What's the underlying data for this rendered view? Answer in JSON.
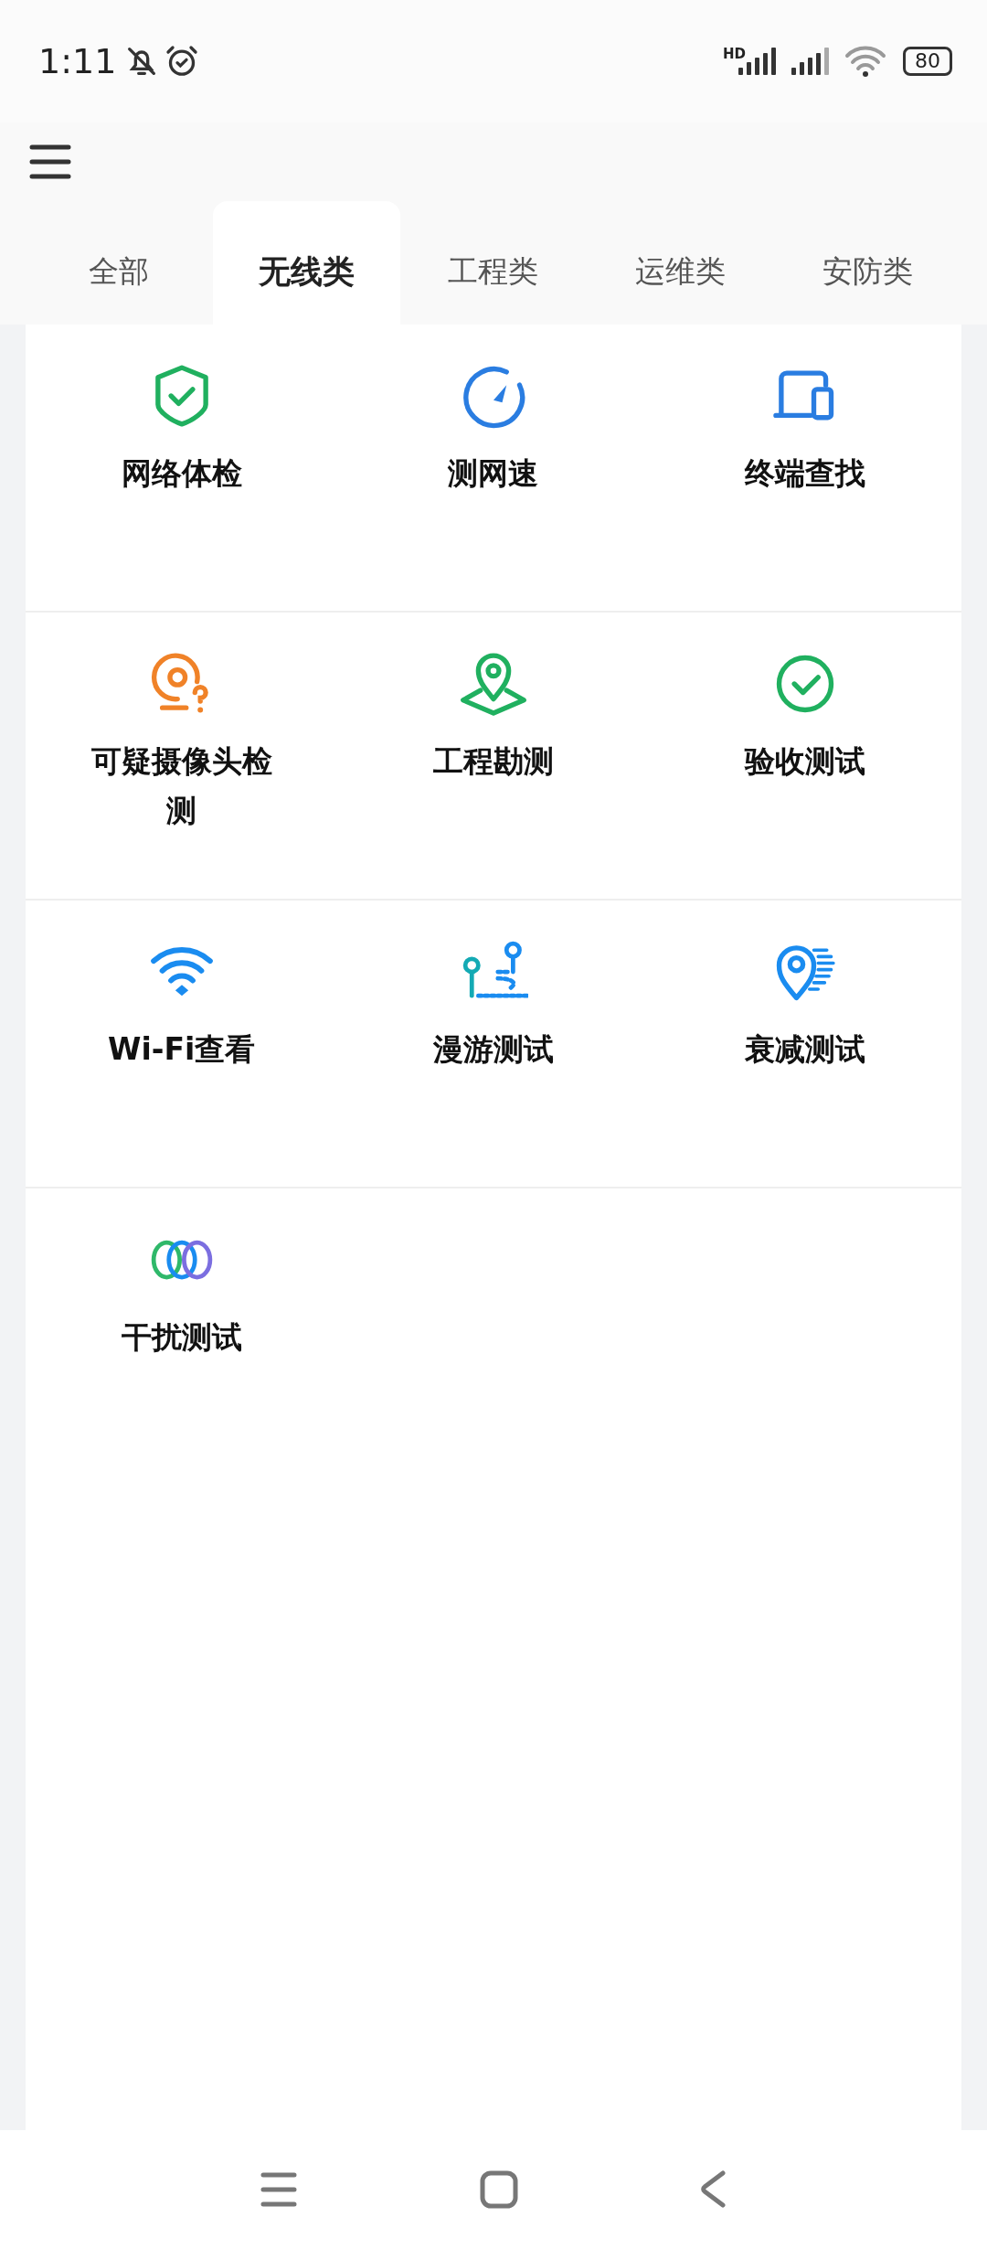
{
  "status_bar": {
    "time": "1:11",
    "network_label": "HD",
    "battery": "80"
  },
  "tabs": [
    {
      "label": "全部",
      "selected": false
    },
    {
      "label": "无线类",
      "selected": true
    },
    {
      "label": "工程类",
      "selected": false
    },
    {
      "label": "运维类",
      "selected": false
    },
    {
      "label": "安防类",
      "selected": false
    }
  ],
  "tools": [
    {
      "label": "网络体检"
    },
    {
      "label": "测网速"
    },
    {
      "label": "终端查找"
    },
    {
      "label": "可疑摄像头检测"
    },
    {
      "label": "工程勘测"
    },
    {
      "label": "验收测试"
    },
    {
      "label": "Wi-Fi查看"
    },
    {
      "label": "漫游测试"
    },
    {
      "label": "衰减测试"
    },
    {
      "label": "干扰测试"
    }
  ]
}
